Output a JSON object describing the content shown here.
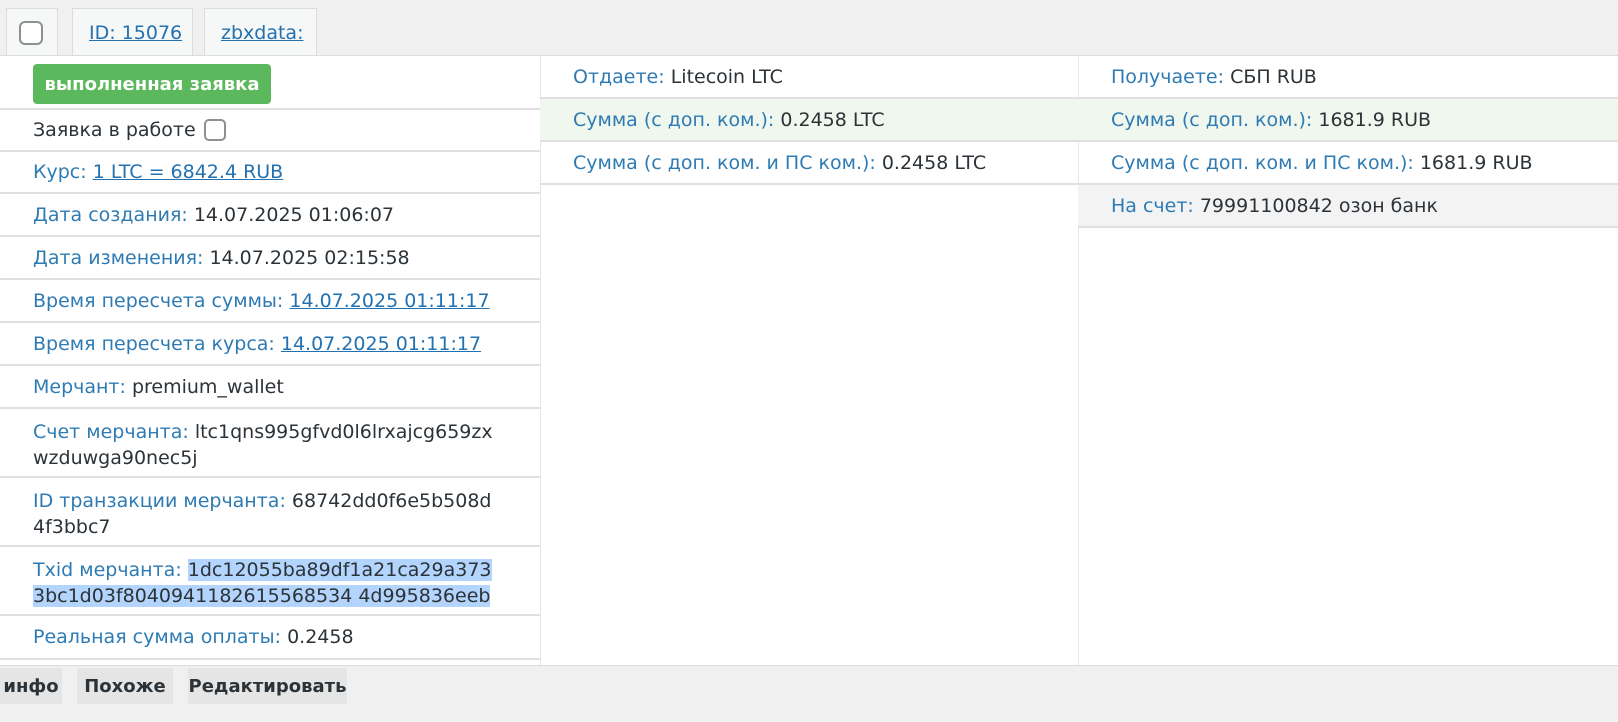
{
  "tabs": {
    "id_label": "ID: 15076",
    "zbx_label": "zbxdata:"
  },
  "left": {
    "status_button": "выполненная заявка",
    "in_work_label": "Заявка в работе",
    "rate_label": "Курс: ",
    "rate_value": "1 LTC = 6842.4 RUB",
    "created_label": "Дата создания: ",
    "created_value": "14.07.2025 01:06:07",
    "modified_label": "Дата изменения: ",
    "modified_value": "14.07.2025 02:15:58",
    "sum_recalc_label": "Время пересчета суммы: ",
    "sum_recalc_value": "14.07.2025 01:11:17",
    "rate_recalc_label": "Время пересчета курса: ",
    "rate_recalc_value": "14.07.2025 01:11:17",
    "merchant_label": "Мерчант: ",
    "merchant_value": "premium_wallet",
    "merchant_account_label": "Счет мерчанта: ",
    "merchant_account_value": "ltc1qns995gfvd0l6lrxajcg659zxwzduwga90nec5j",
    "merchant_txn_label": "ID транзакции мерчанта: ",
    "merchant_txn_value": "68742dd0f6e5b508d4f3bbc7",
    "merchant_txid_label": "Txid мерчанта: ",
    "merchant_txid_value": "1dc12055ba89df1a21ca29a3733bc1d03f8040941182615568534 4d995836eeb",
    "real_sum_label": "Реальная сумма оплаты: ",
    "real_sum_value": "0.2458"
  },
  "middle": {
    "give_label": "Отдаете: ",
    "give_value": "Litecoin LTC",
    "sum_fee_label": "Сумма (с доп. ком.): ",
    "sum_fee_value": "0.2458 LTC",
    "sum_fee_ps_label": "Сумма (с доп. ком. и ПС ком.): ",
    "sum_fee_ps_value": "0.2458 LTC"
  },
  "right": {
    "get_label": "Получаете: ",
    "get_value": "СБП RUB",
    "sum_fee_label": "Сумма (с доп. ком.): ",
    "sum_fee_value": "1681.9 RUB",
    "sum_fee_ps_label": "Сумма (с доп. ком. и ПС ком.): ",
    "sum_fee_ps_value": "1681.9 RUB",
    "account_label": "На счет: ",
    "account_value": "79991100842 озон банк"
  },
  "bottom": {
    "info": "инфо",
    "similar": "Похоже",
    "edit": "Редактировать"
  },
  "colors": {
    "label_blue": "#2e7bb4",
    "link_blue": "#2271b1",
    "status_green": "#5cb85c",
    "selection": "#b3d4fc"
  }
}
